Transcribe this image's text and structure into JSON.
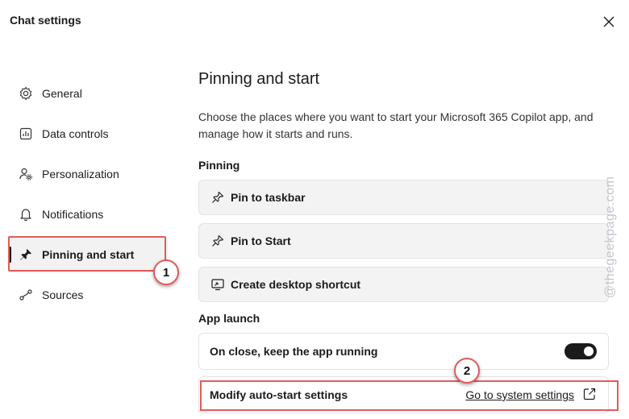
{
  "window": {
    "title": "Chat settings"
  },
  "sidebar": {
    "items": [
      {
        "label": "General",
        "icon": "gear-icon"
      },
      {
        "label": "Data controls",
        "icon": "chart-icon"
      },
      {
        "label": "Personalization",
        "icon": "person-gear-icon"
      },
      {
        "label": "Notifications",
        "icon": "bell-icon"
      },
      {
        "label": "Pinning and start",
        "icon": "pin-icon",
        "active": true
      },
      {
        "label": "Sources",
        "icon": "sources-icon"
      }
    ]
  },
  "main": {
    "title": "Pinning and start",
    "description": "Choose the places where you want to start your Microsoft 365 Copilot app, and manage how it starts and runs.",
    "pinning": {
      "label": "Pinning",
      "buttons": [
        {
          "label": "Pin to taskbar",
          "icon": "pin-outline-icon"
        },
        {
          "label": "Pin to Start",
          "icon": "pin-outline-icon"
        },
        {
          "label": "Create desktop shortcut",
          "icon": "desktop-shortcut-icon"
        }
      ]
    },
    "app_launch": {
      "label": "App launch",
      "keep_running_label": "On close, keep the app running",
      "keep_running_on": true,
      "autostart_label": "Modify auto-start settings",
      "autostart_link": "Go to system settings"
    }
  },
  "annotations": {
    "badge1": "1",
    "badge2": "2"
  },
  "watermark": "@thegeekpage.com",
  "colors": {
    "highlight": "#e25b5b",
    "toggle_on": "#1b1b1b",
    "button_bg": "#f3f3f3"
  }
}
